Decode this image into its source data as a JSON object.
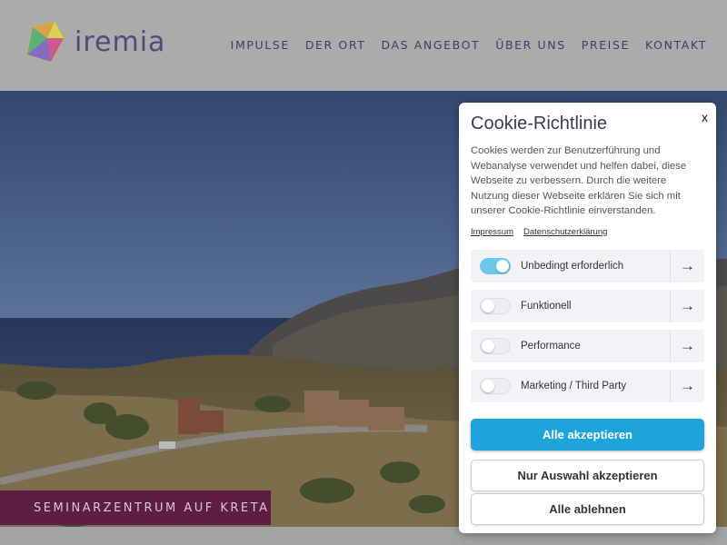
{
  "header": {
    "logo_text": "iremia",
    "nav": [
      "IMPULSE",
      "DER ORT",
      "DAS ANGEBOT",
      "ÜBER UNS",
      "PREISE",
      "KONTAKT"
    ]
  },
  "hero": {
    "caption": "SEMINARZENTRUM AUF KRETA"
  },
  "cookie": {
    "close": "x",
    "title": "Cookie-Richtlinie",
    "text": "Cookies werden zur Benutzerführung und Webanalyse verwendet und helfen dabei, diese Webseite zu verbessern. Durch die weitere Nutzung dieser Webseite erklären Sie sich mit unserer Cookie-Richtlinie einverstanden.",
    "links": {
      "impressum": "Impressum",
      "privacy": "Datenschutzerklärung"
    },
    "categories": [
      {
        "label": "Unbedingt erforderlich",
        "enabled": true
      },
      {
        "label": "Funktionell",
        "enabled": false
      },
      {
        "label": "Performance",
        "enabled": false
      },
      {
        "label": "Marketing / Third Party",
        "enabled": false
      }
    ],
    "arrow": "→",
    "buttons": {
      "accept_all": "Alle akzeptieren",
      "accept_selection": "Nur Auswahl akzeptieren",
      "reject_all": "Alle ablehnen"
    },
    "colors": {
      "primary": "#1ea3db",
      "toggle_on": "#6cc7ec"
    }
  }
}
